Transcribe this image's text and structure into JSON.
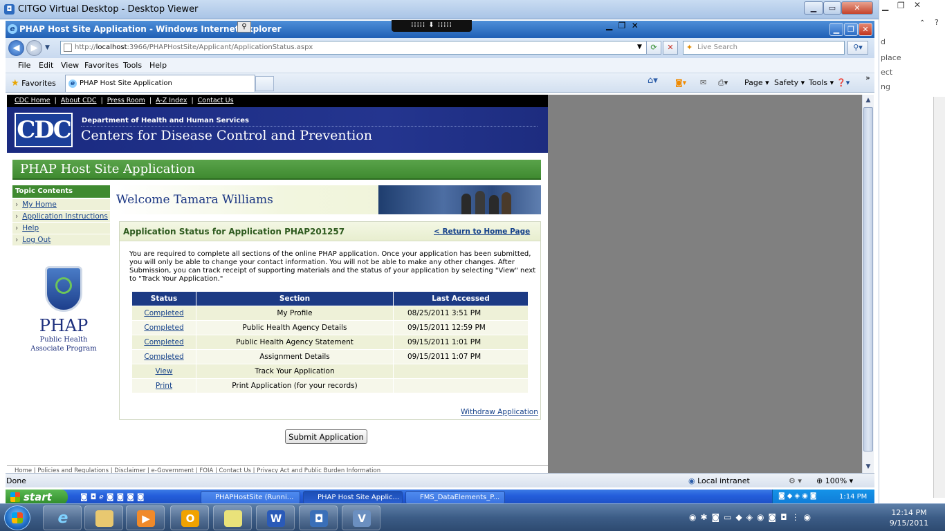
{
  "outer_window": {
    "title": "CITGO Virtual Desktop - Desktop Viewer"
  },
  "ie_window": {
    "title": "PHAP Host Site Application - Windows Internet Explorer"
  },
  "address_bar": {
    "url_prefix": "http://",
    "url_host": "localhost",
    "url_rest": ":3966/PHAPHostSite/Applicant/ApplicationStatus.aspx",
    "search_placeholder": "Live Search"
  },
  "menu": [
    "File",
    "Edit",
    "View",
    "Favorites",
    "Tools",
    "Help"
  ],
  "favorites_label": "Favorites",
  "active_tab": "PHAP Host Site Application",
  "command_bar": {
    "page": "Page",
    "safety": "Safety",
    "tools": "Tools"
  },
  "top_links": [
    "CDC Home",
    "About CDC",
    "Press Room",
    "A-Z Index",
    "Contact Us"
  ],
  "banner": {
    "logo_text": "CDC",
    "dept": "Department of Health and Human Services",
    "agency": "Centers for Disease Control and Prevention"
  },
  "app_title": "PHAP Host Site Application",
  "sidebar": {
    "header": "Topic Contents",
    "items": [
      {
        "label": "My Home"
      },
      {
        "label": "Application Instructions"
      },
      {
        "label": "Help"
      },
      {
        "label": "Log Out"
      }
    ]
  },
  "phap_logo": {
    "word": "PHAP",
    "line1": "Public Health",
    "line2": "Associate Program"
  },
  "welcome": "Welcome Tamara Williams",
  "status_section": {
    "title": "Application Status for Application PHAP201257",
    "return_link": "< Return to Home Page",
    "paragraph": "You are required to complete all sections of the online PHAP application. Once your application has been submitted, you will only be able to change your contact information. You will not be able to make any other changes. After Submission, you can track receipt of supporting materials and the status of your application by selecting \"View\" next to \"Track Your Application.\"",
    "columns": [
      "Status",
      "Section",
      "Last Accessed"
    ],
    "rows": [
      {
        "status": "Completed",
        "section": "My Profile",
        "last": "08/25/2011 3:51 PM"
      },
      {
        "status": "Completed",
        "section": "Public Health Agency Details",
        "last": "09/15/2011 12:59 PM"
      },
      {
        "status": "Completed",
        "section": "Public Health Agency Statement",
        "last": "09/15/2011 1:01 PM"
      },
      {
        "status": "Completed",
        "section": "Assignment Details",
        "last": "09/15/2011 1:07 PM"
      },
      {
        "status": "View",
        "section": "Track Your Application",
        "last": ""
      },
      {
        "status": "Print",
        "section": "Print Application (for your records)",
        "last": ""
      }
    ],
    "withdraw": "Withdraw Application",
    "submit": "Submit Application"
  },
  "footer_links": "Home  |  Policies and Regulations  |  Disclaimer  |  e-Government  |  FOIA  |  Contact Us  |  Privacy Act and Public Burden Information",
  "statusbar": {
    "left": "Done",
    "zone": "Local intranet",
    "zoom": "100%"
  },
  "xp_taskbar": {
    "start": "start",
    "tasks": [
      "PHAPHostSite (Runni...",
      "PHAP Host Site Applic...",
      "FMS_DataElements_P..."
    ],
    "clock": "1:14 PM"
  },
  "win7_taskbar": {
    "time": "12:14 PM",
    "date": "9/15/2011"
  },
  "host_fragments": [
    "d",
    "place",
    "ect",
    "ng"
  ]
}
